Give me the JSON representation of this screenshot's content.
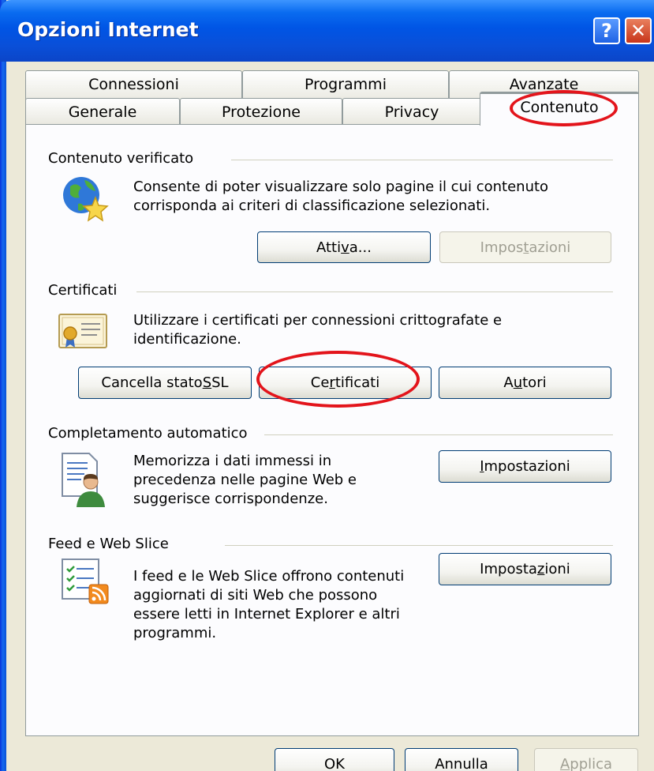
{
  "window": {
    "title": "Opzioni Internet",
    "help_glyph": "?",
    "close_glyph": "✕"
  },
  "tabs": {
    "row1": [
      {
        "label": "Connessioni"
      },
      {
        "label": "Programmi"
      },
      {
        "label": "Avanzate"
      }
    ],
    "row2": [
      {
        "label": "Generale"
      },
      {
        "label": "Protezione"
      },
      {
        "label": "Privacy"
      },
      {
        "label": "Contenuto",
        "selected": true
      }
    ]
  },
  "sections": {
    "verified": {
      "title": "Contenuto verificato",
      "description": [
        "Consente di poter visualizzare solo pagine il cui contenuto",
        "corrisponda ai criteri di classificazione selezionati."
      ],
      "enable_button": {
        "pre": "Atti",
        "u": "v",
        "post": "a..."
      },
      "settings_button": {
        "pre": "Impos",
        "u": "t",
        "post": "azioni",
        "disabled": true
      },
      "icon": "globe-star-icon"
    },
    "certificates": {
      "title": "Certificati",
      "description": [
        "Utilizzare i certificati per connessioni crittografate e",
        "identificazione."
      ],
      "clear_ssl_button": {
        "pre": "Cancella stato ",
        "u": "S",
        "post": "SL"
      },
      "certificates_button": {
        "pre": "Ce",
        "u": "r",
        "post": "tificati"
      },
      "publishers_button": {
        "pre": "A",
        "u": "u",
        "post": "tori"
      },
      "icon": "certificate-icon"
    },
    "autocomplete": {
      "title": "Completamento automatico",
      "description": [
        "Memorizza i dati immessi in",
        "precedenza nelle pagine Web e",
        "suggerisce corrispondenze."
      ],
      "settings_button": {
        "pre": "",
        "u": "I",
        "post": "mpostazioni"
      },
      "icon": "user-form-icon"
    },
    "feeds": {
      "title": "Feed e Web Slice",
      "description": [
        "I feed e le Web Slice offrono contenuti",
        "aggiornati di siti Web che possono",
        "essere letti in Internet Explorer e altri",
        "programmi."
      ],
      "settings_button": {
        "pre": "Imposta",
        "u": "z",
        "post": "ioni"
      },
      "icon": "feed-list-icon"
    }
  },
  "footer": {
    "ok": "OK",
    "cancel": "Annulla",
    "apply": {
      "pre": "",
      "u": "A",
      "post": "pplica",
      "disabled": true
    }
  },
  "colors": {
    "annotation_circle": "#e3141b",
    "title_bar": "#0055e5",
    "selected_tab_accent": "#f5a623"
  }
}
